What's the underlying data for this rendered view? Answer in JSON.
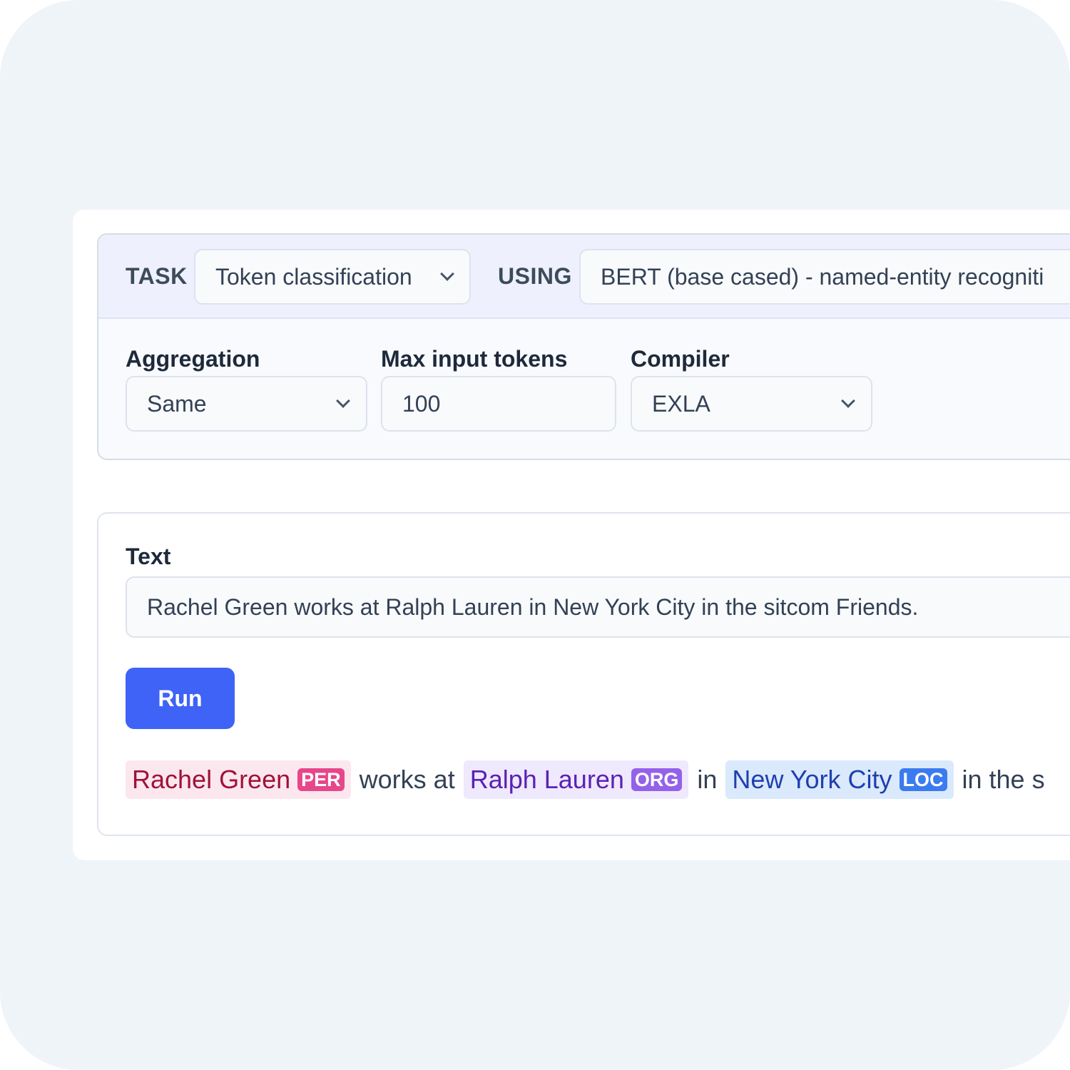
{
  "header": {
    "task_label": "TASK",
    "task_value": "Token classification",
    "using_label": "USING",
    "using_value": "BERT (base cased) - named-entity recogniti"
  },
  "fields": {
    "aggregation_label": "Aggregation",
    "aggregation_value": "Same",
    "max_tokens_label": "Max input tokens",
    "max_tokens_value": "100",
    "compiler_label": "Compiler",
    "compiler_value": "EXLA"
  },
  "text_section": {
    "label": "Text",
    "value": "Rachel Green works at Ralph Lauren in New York City in the sitcom Friends.",
    "run_label": "Run"
  },
  "result": {
    "entity1": "Rachel Green",
    "entity1_tag": "PER",
    "text1": "works at",
    "entity2": "Ralph Lauren",
    "entity2_tag": "ORG",
    "text2": "in",
    "entity3": "New York City",
    "entity3_tag": "LOC",
    "text3": "in the s"
  },
  "colors": {
    "per_bg": "#fce7ef",
    "per_text": "#9f1239",
    "per_tag": "#e8468b",
    "org_bg": "#efe9fd",
    "org_text": "#5b21b6",
    "org_tag": "#9461ea",
    "loc_bg": "#dbe9fd",
    "loc_text": "#1e40af",
    "loc_tag": "#3b7bf0",
    "run_button": "#3e63f6"
  },
  "icons": [
    "chevron-down-icon"
  ]
}
